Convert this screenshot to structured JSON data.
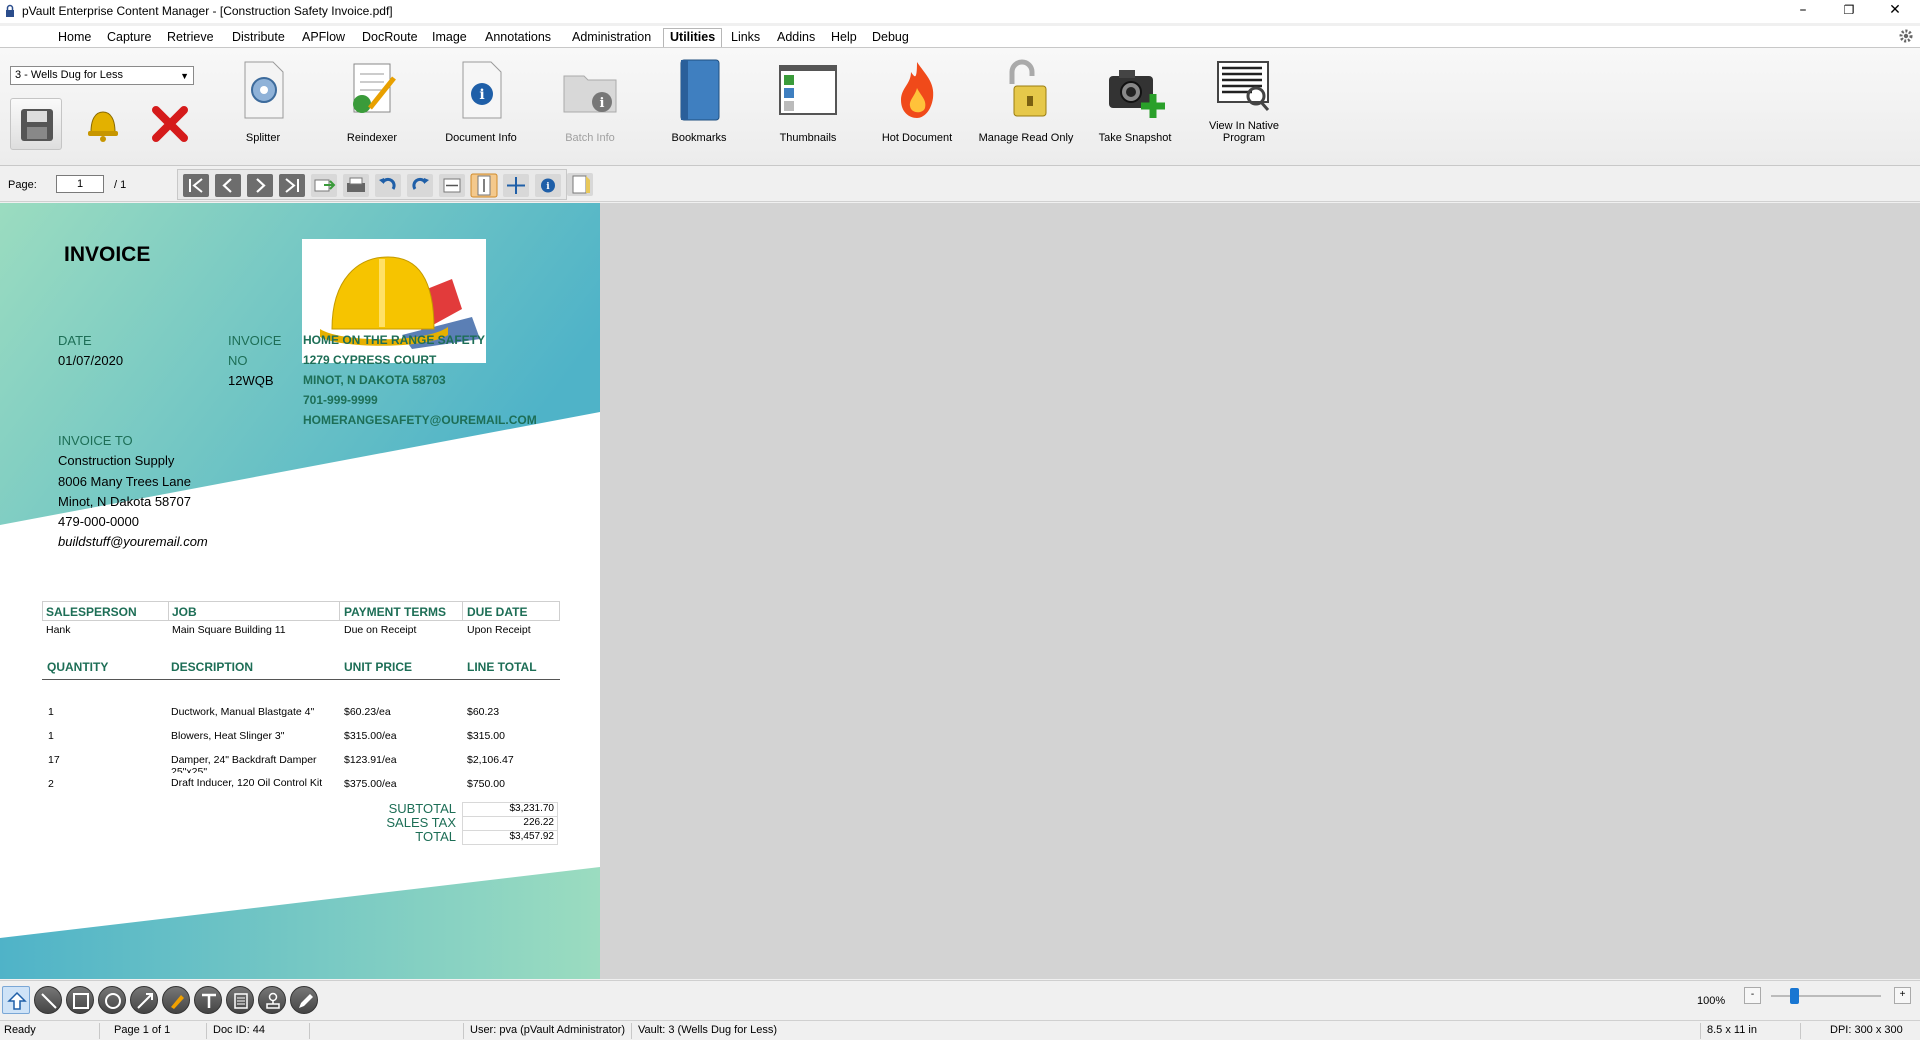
{
  "window": {
    "title": "pVault Enterprise Content Manager - [Construction Safety Invoice.pdf]",
    "minimize": "–",
    "restore": "❐",
    "close": "✕"
  },
  "menu": [
    "Home",
    "Capture",
    "Retrieve",
    "Distribute",
    "APFlow",
    "DocRoute",
    "Image",
    "Annotations",
    "Administration",
    "Utilities",
    "Links",
    "Addins",
    "Help",
    "Debug"
  ],
  "active_menu": "Utilities",
  "ribbon": {
    "vault_selected": "3 - Wells Dug for Less",
    "buttons": {
      "splitter": "Splitter",
      "reindexer": "Reindexer",
      "document_info": "Document Info",
      "batch_info": "Batch Info",
      "bookmarks": "Bookmarks",
      "thumbnails": "Thumbnails",
      "hot_document": "Hot Document",
      "manage_read_only": "Manage Read Only",
      "take_snapshot": "Take Snapshot",
      "view_native_1": "View In Native",
      "view_native_2": "Program"
    }
  },
  "pagebar": {
    "label": "Page:",
    "current": "1",
    "total": "/ 1"
  },
  "invoice": {
    "title": "INVOICE",
    "date_label": "DATE",
    "date": "01/07/2020",
    "invoice_label_1": "INVOICE",
    "invoice_label_2": "NO",
    "invoice_no": "12WQB",
    "company": [
      "HOME ON THE RANGE SAFETY",
      "1279 CYPRESS COURT",
      "MINOT, N DAKOTA 58703",
      "701-999-9999",
      "HOMERANGESAFETY@OUREMAIL.COM"
    ],
    "invoice_to_label": "INVOICE TO",
    "bill_to": [
      "Construction Supply",
      "8006 Many Trees Lane",
      "Minot, N Dakota 58707",
      "479-000-0000"
    ],
    "bill_email": "buildstuff@youremail.com",
    "info_headers": [
      "SALESPERSON",
      "JOB",
      "PAYMENT TERMS",
      "DUE DATE"
    ],
    "info_values": [
      "Hank",
      "Main Square Building 11",
      "Due on Receipt",
      "Upon Receipt"
    ],
    "item_headers": [
      "QUANTITY",
      "DESCRIPTION",
      "UNIT PRICE",
      "LINE TOTAL"
    ],
    "items": [
      {
        "qty": "1",
        "desc": "Ductwork, Manual Blastgate 4\"",
        "price": "$60.23/ea",
        "total": "$60.23"
      },
      {
        "qty": "1",
        "desc": "Blowers, Heat Slinger 3\"",
        "price": "$315.00/ea",
        "total": "$315.00"
      },
      {
        "qty": "17",
        "desc": "Damper, 24\" Backdraft Damper",
        "desc2": "25\"x25\"",
        "price": "$123.91/ea",
        "total": "$2,106.47"
      },
      {
        "qty": "2",
        "desc": "Draft Inducer, 120 Oil Control Kit",
        "price": "$375.00/ea",
        "total": "$750.00"
      }
    ],
    "subtotal_label": "SUBTOTAL",
    "subtotal": "$3,231.70",
    "tax_label": "SALES TAX",
    "tax": "226.22",
    "total_label": "TOTAL",
    "total": "$3,457.92",
    "colors": {
      "accent": "#1d6e56",
      "teal": "#4fb3c8",
      "mint": "#9bdcc0"
    }
  },
  "zoom": {
    "label": "100%",
    "minus": "-",
    "plus": "+"
  },
  "status": {
    "state": "Ready",
    "page": "Page 1 of 1",
    "doc_id": "Doc ID: 44",
    "user": "User: pva (pVault Administrator)",
    "vault": "Vault: 3 (Wells Dug for Less)",
    "size": "8.5 x 11 in",
    "dpi": "DPI: 300 x 300"
  }
}
